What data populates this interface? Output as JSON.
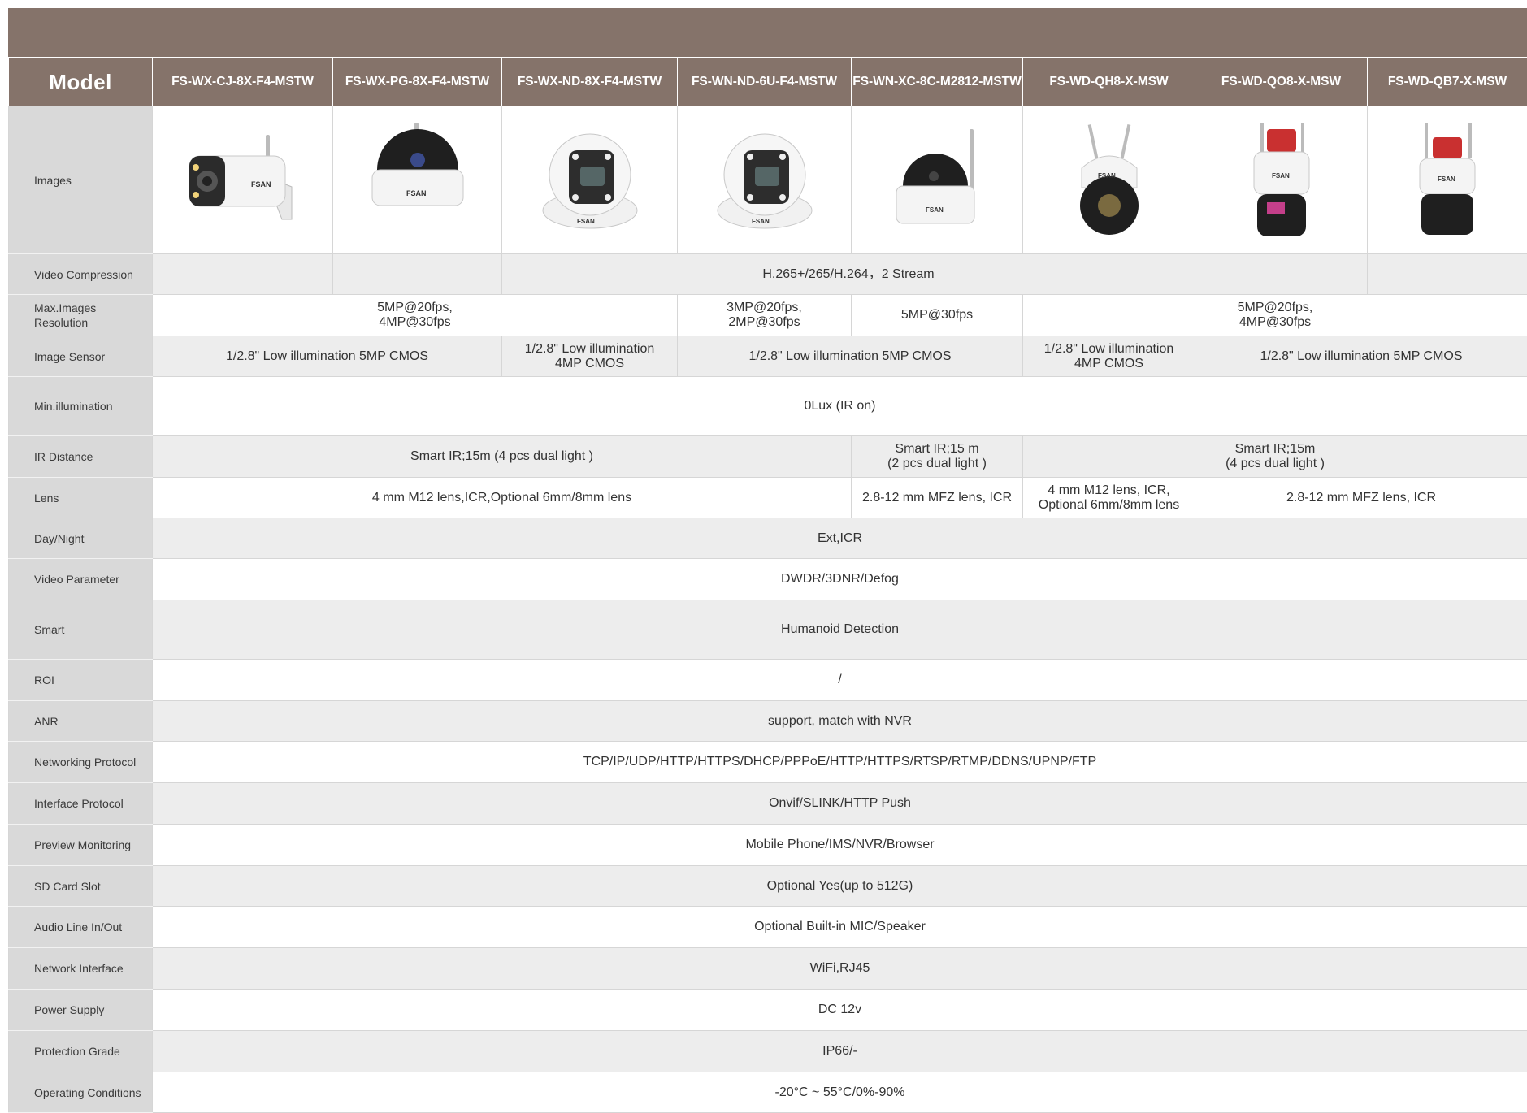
{
  "table": {
    "model_label": "Model",
    "models": [
      "FS-WX-CJ-8X-F4-MSTW",
      "FS-WX-PG-8X-F4-MSTW",
      "FS-WX-ND-8X-F4-MSTW",
      "FS-WN-ND-6U-F4-MSTW",
      "FS-WN-XC-8C-M2812-MSTW",
      "FS-WD-QH8-X-MSW",
      "FS-WD-QO8-X-MSW",
      "FS-WD-QB7-X-MSW"
    ],
    "images_label": "Images",
    "brand_mark": "FSAN",
    "images": [
      {
        "model": "FS-WX-CJ-8X-F4-MSTW",
        "kind": "bullet-camera-icon"
      },
      {
        "model": "FS-WX-PG-8X-F4-MSTW",
        "kind": "dome-camera-antenna-icon"
      },
      {
        "model": "FS-WX-ND-8X-F4-MSTW",
        "kind": "turret-camera-icon"
      },
      {
        "model": "FS-WN-ND-6U-F4-MSTW",
        "kind": "turret-camera-icon"
      },
      {
        "model": "FS-WN-XC-8C-M2812-MSTW",
        "kind": "dome-camera-antenna-icon"
      },
      {
        "model": "FS-WD-QH8-X-MSW",
        "kind": "ptz-camera-icon"
      },
      {
        "model": "FS-WD-QO8-X-MSW",
        "kind": "ptz-siren-camera-icon"
      },
      {
        "model": "FS-WD-QB7-X-MSW",
        "kind": "ptz-siren-camera-icon"
      }
    ],
    "rows": {
      "video_compression": {
        "label": "Video Compression",
        "value": "H.265+/265/H.264，2 Stream"
      },
      "max_resolution": {
        "label": "Max.Images Resolution",
        "a": "5MP@20fps,\n4MP@30fps",
        "b": "3MP@20fps,\n2MP@30fps",
        "c": "5MP@30fps",
        "d": "5MP@20fps,\n4MP@30fps"
      },
      "image_sensor": {
        "label": "Image Sensor",
        "a": "1/2.8\" Low illumination  5MP CMOS",
        "b": "1/2.8\" Low illumination\n4MP CMOS",
        "c": "1/2.8\" Low illumination  5MP CMOS",
        "d": "1/2.8\" Low illumination\n4MP CMOS",
        "e": "1/2.8\" Low illumination  5MP CMOS"
      },
      "min_illumination": {
        "label": "Min.illumination",
        "value": "0Lux (IR on)"
      },
      "ir_distance": {
        "label": "IR Distance",
        "a": "Smart IR;15m (4 pcs dual light )",
        "b": "Smart IR;15 m\n(2 pcs dual light )",
        "c": "Smart IR;15m\n(4 pcs dual light )"
      },
      "lens": {
        "label": "Lens",
        "a": "4 mm M12 lens,ICR,Optional 6mm/8mm lens",
        "b": "2.8-12 mm MFZ  lens, ICR",
        "c": "4 mm M12 lens, ICR,\nOptional 6mm/8mm lens",
        "d": "2.8-12 mm MFZ  lens, ICR"
      },
      "day_night": {
        "label": "Day/Night",
        "value": "Ext,ICR"
      },
      "video_parameter": {
        "label": "Video Parameter",
        "value": "DWDR/3DNR/Defog"
      },
      "smart": {
        "label": "Smart",
        "value": "Humanoid Detection"
      },
      "roi": {
        "label": "ROI",
        "value": "/"
      },
      "anr": {
        "label": "ANR",
        "value": "support, match  with NVR"
      },
      "networking_protocol": {
        "label": "Networking Protocol",
        "value": "TCP/IP/UDP/HTTP/HTTPS/DHCP/PPPoE/HTTP/HTTPS/RTSP/RTMP/DDNS/UPNP/FTP"
      },
      "interface_protocol": {
        "label": "Interface Protocol",
        "value": "Onvif/SLINK/HTTP Push"
      },
      "preview_monitoring": {
        "label": "Preview  Monitoring",
        "value": "Mobile Phone/IMS/NVR/Browser"
      },
      "sd_card": {
        "label": "SD Card Slot",
        "value": "Optional Yes(up to 512G)"
      },
      "audio": {
        "label": "Audio Line In/Out",
        "value": "Optional Built-in MIC/Speaker"
      },
      "network_interface": {
        "label": "Network Interface",
        "value": "WiFi,RJ45"
      },
      "power_supply": {
        "label": "Power Supply",
        "value": "DC 12v"
      },
      "protection_grade": {
        "label": "Protection Grade",
        "value": "IP66/-"
      },
      "operating_conditions": {
        "label": "Operating Conditions",
        "value": "-20°C ~ 55°C/0%-90%"
      }
    }
  },
  "colors": {
    "header": "#85736a",
    "label_bg": "#d9d9d9",
    "row_gray": "#ededed"
  }
}
